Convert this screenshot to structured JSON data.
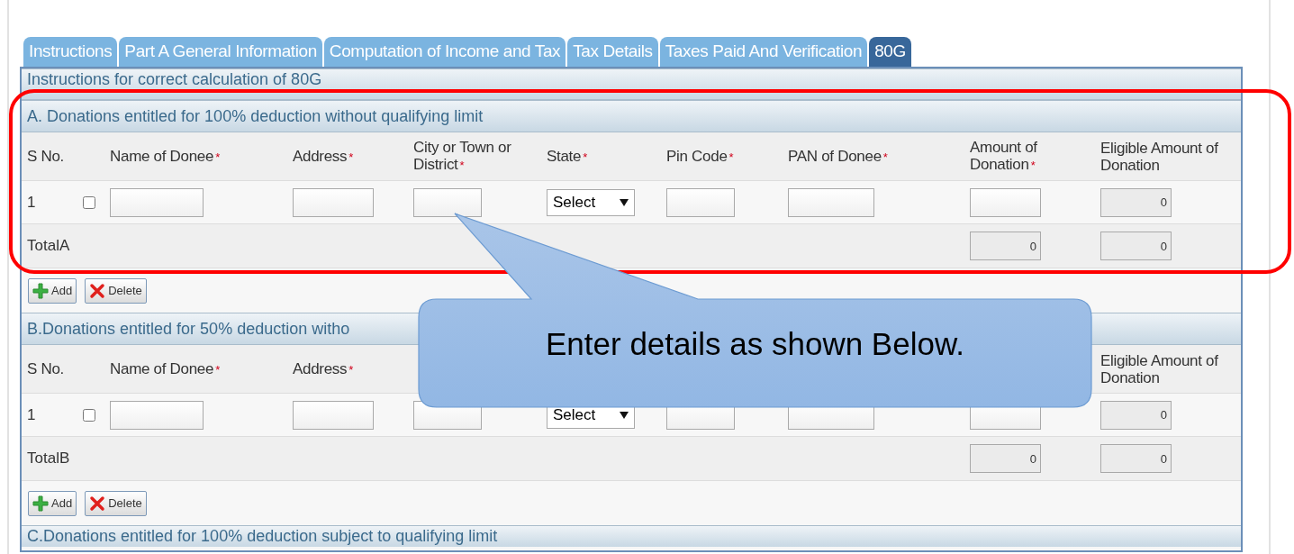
{
  "tabs": [
    {
      "label": "Instructions",
      "selected": false
    },
    {
      "label": "Part A General Information",
      "selected": false
    },
    {
      "label": "Computation of Income and Tax",
      "selected": false
    },
    {
      "label": "Tax Details",
      "selected": false
    },
    {
      "label": "Taxes Paid And Verification",
      "selected": false
    },
    {
      "label": "80G",
      "selected": true
    }
  ],
  "instructions_bar": "Instructions for correct calculation of 80G",
  "sections": [
    {
      "title": "A. Donations entitled for 100% deduction without qualifying limit",
      "columns": [
        {
          "kind": "sno",
          "label": "S No."
        },
        {
          "kind": "name",
          "label": "Name of Donee",
          "mark": "*"
        },
        {
          "kind": "address",
          "label": "Address",
          "mark": "*"
        },
        {
          "kind": "city",
          "label": "City or Town or District",
          "mark": "*"
        },
        {
          "kind": "state",
          "label": "State",
          "mark": "*"
        },
        {
          "kind": "pin",
          "label": "Pin Code",
          "mark": "*"
        },
        {
          "kind": "pan",
          "label": "PAN of Donee",
          "mark": "*"
        },
        {
          "kind": "amount",
          "label": "Amount of Donation",
          "mark": "*"
        },
        {
          "kind": "eligible",
          "label": "Eligible Amount of Donation"
        }
      ],
      "rows": [
        {
          "sno": "1",
          "checked": false,
          "state": "Select",
          "eligible": "0"
        }
      ],
      "total": {
        "label": "TotalA",
        "amount": "0",
        "eligible": "0"
      },
      "buttons": [
        {
          "kind": "add",
          "label": "Add"
        },
        {
          "kind": "delete",
          "label": "Delete"
        }
      ]
    },
    {
      "title": "B.Donations entitled for 50% deduction witho",
      "columns": [
        {
          "kind": "sno",
          "label": "S No."
        },
        {
          "kind": "name",
          "label": "Name of Donee",
          "mark": "*"
        },
        {
          "kind": "address",
          "label": "Address",
          "mark": "*"
        },
        {
          "kind": "eligible",
          "label": "Eligible Amount of Donation"
        }
      ],
      "rows": [
        {
          "sno": "1",
          "checked": false,
          "state": "Select",
          "eligible": "0"
        }
      ],
      "total": {
        "label": "TotalB",
        "amount": "0",
        "eligible": "0"
      },
      "buttons": [
        {
          "kind": "add",
          "label": "Add"
        },
        {
          "kind": "delete",
          "label": "Delete"
        }
      ]
    },
    {
      "title": "C.Donations entitled for 100% deduction subject to qualifying limit"
    }
  ],
  "annotations": {
    "highlight_frame": true,
    "callout": "Enter details as shown Below."
  }
}
